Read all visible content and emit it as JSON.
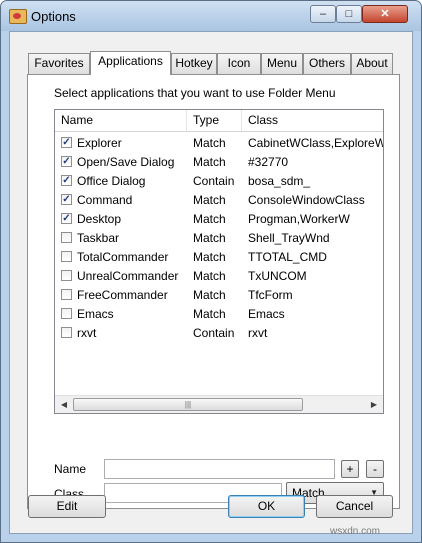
{
  "window": {
    "title": "Options",
    "controls": {
      "minimize": "–",
      "maximize": "□",
      "close": "✕"
    }
  },
  "tabs": [
    {
      "label": "Favorites",
      "active": false
    },
    {
      "label": "Applications",
      "active": true
    },
    {
      "label": "Hotkey",
      "active": false
    },
    {
      "label": "Icon",
      "active": false
    },
    {
      "label": "Menu",
      "active": false
    },
    {
      "label": "Others",
      "active": false
    },
    {
      "label": "About",
      "active": false
    }
  ],
  "applications": {
    "prompt": "Select applications that you want to use Folder Menu",
    "columns": [
      "Name",
      "Type",
      "Class"
    ],
    "rows": [
      {
        "checked": true,
        "name": "Explorer",
        "type": "Match",
        "class": "CabinetWClass,ExploreWClass"
      },
      {
        "checked": true,
        "name": "Open/Save Dialog",
        "type": "Match",
        "class": "#32770"
      },
      {
        "checked": true,
        "name": "Office Dialog",
        "type": "Contain",
        "class": "bosa_sdm_"
      },
      {
        "checked": true,
        "name": "Command",
        "type": "Match",
        "class": "ConsoleWindowClass"
      },
      {
        "checked": true,
        "name": "Desktop",
        "type": "Match",
        "class": "Progman,WorkerW"
      },
      {
        "checked": false,
        "name": "Taskbar",
        "type": "Match",
        "class": "Shell_TrayWnd"
      },
      {
        "checked": false,
        "name": "TotalCommander",
        "type": "Match",
        "class": "TTOTAL_CMD"
      },
      {
        "checked": false,
        "name": "UnrealCommander",
        "type": "Match",
        "class": "TxUNCOM"
      },
      {
        "checked": false,
        "name": "FreeCommander",
        "type": "Match",
        "class": "TfcForm"
      },
      {
        "checked": false,
        "name": "Emacs",
        "type": "Match",
        "class": "Emacs"
      },
      {
        "checked": false,
        "name": "rxvt",
        "type": "Contain",
        "class": "rxvt"
      }
    ],
    "scroll": {
      "left": "◀",
      "right": "▶",
      "grip": "|||"
    }
  },
  "form": {
    "name_label": "Name",
    "name_value": "",
    "class_label": "Class",
    "class_value": "",
    "add_label": "+",
    "remove_label": "-",
    "type_selected": "Match"
  },
  "footer": {
    "edit": "Edit",
    "ok": "OK",
    "cancel": "Cancel"
  },
  "watermark": "wsxdn.com"
}
